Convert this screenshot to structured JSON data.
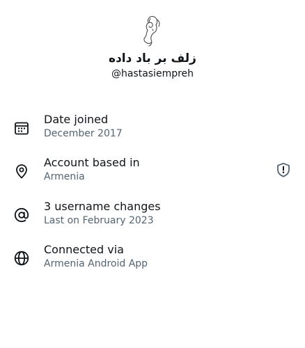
{
  "profile": {
    "display_name": "زلف بر باد داده",
    "username": "@hastasiempreh",
    "avatar_icon": "sketch-avatar-icon"
  },
  "rows": [
    {
      "title": "Date joined",
      "subtitle": "December 2017",
      "icon": "calendar-icon"
    },
    {
      "title": "Account based in",
      "subtitle": "Armenia",
      "icon": "location-pin-icon",
      "side_icon": "shield-alert-icon"
    },
    {
      "title": "3 username changes",
      "subtitle": "Last on February 2023",
      "icon": "at-sign-icon"
    },
    {
      "title": "Connected via",
      "subtitle": "Armenia Android App",
      "icon": "globe-icon"
    }
  ],
  "colors": {
    "primary_text": "#0f1419",
    "secondary_text": "#536471",
    "icon_stroke": "#0f1419",
    "shield_stroke": "#536471",
    "background": "#ffffff"
  }
}
